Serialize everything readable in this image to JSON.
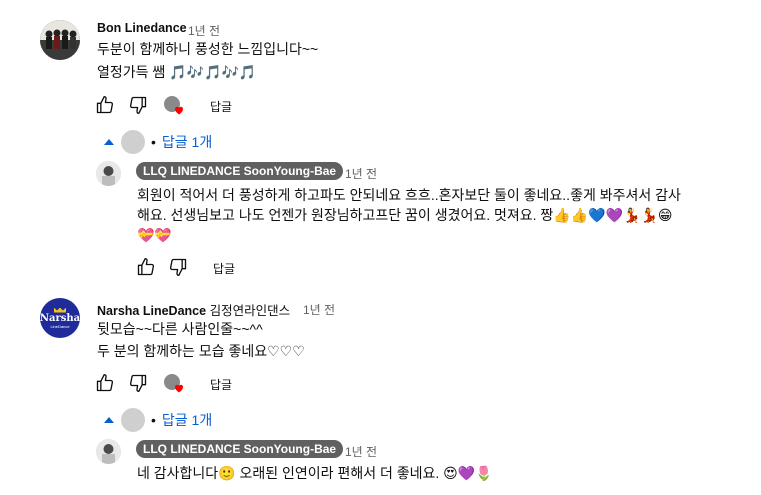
{
  "comments": [
    {
      "author": "Bon Linedance",
      "time": "1년 전",
      "lines": [
        "두분이 함께하니 풍성한 느낌입니다~~",
        "열정가득 쌤"
      ],
      "line2_emoji": "🎵🎶🎵🎶🎵",
      "reply_label": "답글",
      "replies_toggle": "답글 1개",
      "reply": {
        "author": "LLQ LINEDANCE SoonYoung-Bae",
        "time": "1년 전",
        "lines": [
          "회원이 적어서 더 풍성하게 하고파도 안되네요 흐흐..혼자보단 둘이 좋네요..좋게 봐주셔서 감사",
          "해요. 선생님보고 나도 언젠가 원장님하고프단 꿈이 생겼어요. 멋져요. 짱"
        ],
        "line2_emoji": "👍👍💙💜💃💃😁",
        "line3_emoji": "💝💝",
        "reply_label": "답글"
      }
    },
    {
      "author": "Narsha LineDance",
      "author_suffix": "김정연라인댄스",
      "time": "1년 전",
      "avatar_text": "Narsha",
      "avatar_subtext": "LineDance",
      "lines": [
        "뒷모습~~다른 사람인줄~~^^",
        "두 분의 함께하는 모습 좋네요♡♡♡"
      ],
      "reply_label": "답글",
      "replies_toggle": "답글 1개",
      "reply": {
        "author": "LLQ LINEDANCE SoonYoung-Bae",
        "time": "1년 전",
        "text": "네 감사합니다",
        "text_emoji": "🙂",
        "text_rest": " 오래된 인연이라 편해서 더 좋네요.",
        "trail_emoji": "😍💜🌷",
        "reply_label": "답글"
      }
    }
  ],
  "icons": {
    "like": "thumbs-up-icon",
    "dislike": "thumbs-down-icon",
    "creator_heart": "creator-heart-icon",
    "collapse": "caret-up-icon"
  },
  "colors": {
    "link": "#065fd4",
    "chip": "#606060",
    "heart": "#ff0000",
    "narsha_bg": "#1f2a9b"
  }
}
